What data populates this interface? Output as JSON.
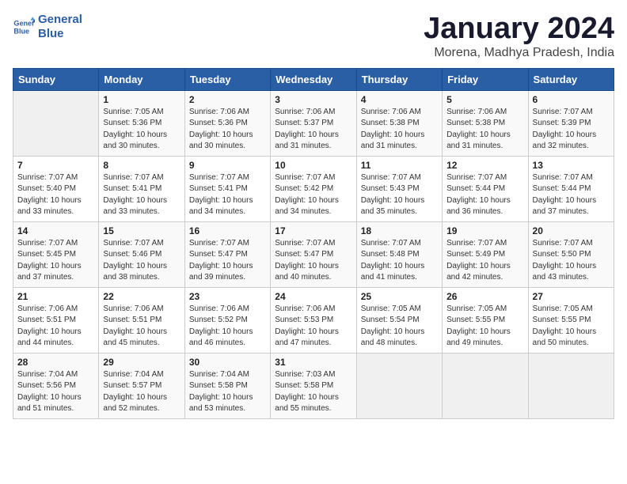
{
  "logo": {
    "line1": "General",
    "line2": "Blue"
  },
  "title": "January 2024",
  "location": "Morena, Madhya Pradesh, India",
  "days_of_week": [
    "Sunday",
    "Monday",
    "Tuesday",
    "Wednesday",
    "Thursday",
    "Friday",
    "Saturday"
  ],
  "weeks": [
    [
      {
        "day": "",
        "info": ""
      },
      {
        "day": "1",
        "info": "Sunrise: 7:05 AM\nSunset: 5:36 PM\nDaylight: 10 hours\nand 30 minutes."
      },
      {
        "day": "2",
        "info": "Sunrise: 7:06 AM\nSunset: 5:36 PM\nDaylight: 10 hours\nand 30 minutes."
      },
      {
        "day": "3",
        "info": "Sunrise: 7:06 AM\nSunset: 5:37 PM\nDaylight: 10 hours\nand 31 minutes."
      },
      {
        "day": "4",
        "info": "Sunrise: 7:06 AM\nSunset: 5:38 PM\nDaylight: 10 hours\nand 31 minutes."
      },
      {
        "day": "5",
        "info": "Sunrise: 7:06 AM\nSunset: 5:38 PM\nDaylight: 10 hours\nand 31 minutes."
      },
      {
        "day": "6",
        "info": "Sunrise: 7:07 AM\nSunset: 5:39 PM\nDaylight: 10 hours\nand 32 minutes."
      }
    ],
    [
      {
        "day": "7",
        "info": "Sunrise: 7:07 AM\nSunset: 5:40 PM\nDaylight: 10 hours\nand 33 minutes."
      },
      {
        "day": "8",
        "info": "Sunrise: 7:07 AM\nSunset: 5:41 PM\nDaylight: 10 hours\nand 33 minutes."
      },
      {
        "day": "9",
        "info": "Sunrise: 7:07 AM\nSunset: 5:41 PM\nDaylight: 10 hours\nand 34 minutes."
      },
      {
        "day": "10",
        "info": "Sunrise: 7:07 AM\nSunset: 5:42 PM\nDaylight: 10 hours\nand 34 minutes."
      },
      {
        "day": "11",
        "info": "Sunrise: 7:07 AM\nSunset: 5:43 PM\nDaylight: 10 hours\nand 35 minutes."
      },
      {
        "day": "12",
        "info": "Sunrise: 7:07 AM\nSunset: 5:44 PM\nDaylight: 10 hours\nand 36 minutes."
      },
      {
        "day": "13",
        "info": "Sunrise: 7:07 AM\nSunset: 5:44 PM\nDaylight: 10 hours\nand 37 minutes."
      }
    ],
    [
      {
        "day": "14",
        "info": "Sunrise: 7:07 AM\nSunset: 5:45 PM\nDaylight: 10 hours\nand 37 minutes."
      },
      {
        "day": "15",
        "info": "Sunrise: 7:07 AM\nSunset: 5:46 PM\nDaylight: 10 hours\nand 38 minutes."
      },
      {
        "day": "16",
        "info": "Sunrise: 7:07 AM\nSunset: 5:47 PM\nDaylight: 10 hours\nand 39 minutes."
      },
      {
        "day": "17",
        "info": "Sunrise: 7:07 AM\nSunset: 5:47 PM\nDaylight: 10 hours\nand 40 minutes."
      },
      {
        "day": "18",
        "info": "Sunrise: 7:07 AM\nSunset: 5:48 PM\nDaylight: 10 hours\nand 41 minutes."
      },
      {
        "day": "19",
        "info": "Sunrise: 7:07 AM\nSunset: 5:49 PM\nDaylight: 10 hours\nand 42 minutes."
      },
      {
        "day": "20",
        "info": "Sunrise: 7:07 AM\nSunset: 5:50 PM\nDaylight: 10 hours\nand 43 minutes."
      }
    ],
    [
      {
        "day": "21",
        "info": "Sunrise: 7:06 AM\nSunset: 5:51 PM\nDaylight: 10 hours\nand 44 minutes."
      },
      {
        "day": "22",
        "info": "Sunrise: 7:06 AM\nSunset: 5:51 PM\nDaylight: 10 hours\nand 45 minutes."
      },
      {
        "day": "23",
        "info": "Sunrise: 7:06 AM\nSunset: 5:52 PM\nDaylight: 10 hours\nand 46 minutes."
      },
      {
        "day": "24",
        "info": "Sunrise: 7:06 AM\nSunset: 5:53 PM\nDaylight: 10 hours\nand 47 minutes."
      },
      {
        "day": "25",
        "info": "Sunrise: 7:05 AM\nSunset: 5:54 PM\nDaylight: 10 hours\nand 48 minutes."
      },
      {
        "day": "26",
        "info": "Sunrise: 7:05 AM\nSunset: 5:55 PM\nDaylight: 10 hours\nand 49 minutes."
      },
      {
        "day": "27",
        "info": "Sunrise: 7:05 AM\nSunset: 5:55 PM\nDaylight: 10 hours\nand 50 minutes."
      }
    ],
    [
      {
        "day": "28",
        "info": "Sunrise: 7:04 AM\nSunset: 5:56 PM\nDaylight: 10 hours\nand 51 minutes."
      },
      {
        "day": "29",
        "info": "Sunrise: 7:04 AM\nSunset: 5:57 PM\nDaylight: 10 hours\nand 52 minutes."
      },
      {
        "day": "30",
        "info": "Sunrise: 7:04 AM\nSunset: 5:58 PM\nDaylight: 10 hours\nand 53 minutes."
      },
      {
        "day": "31",
        "info": "Sunrise: 7:03 AM\nSunset: 5:58 PM\nDaylight: 10 hours\nand 55 minutes."
      },
      {
        "day": "",
        "info": ""
      },
      {
        "day": "",
        "info": ""
      },
      {
        "day": "",
        "info": ""
      }
    ]
  ]
}
